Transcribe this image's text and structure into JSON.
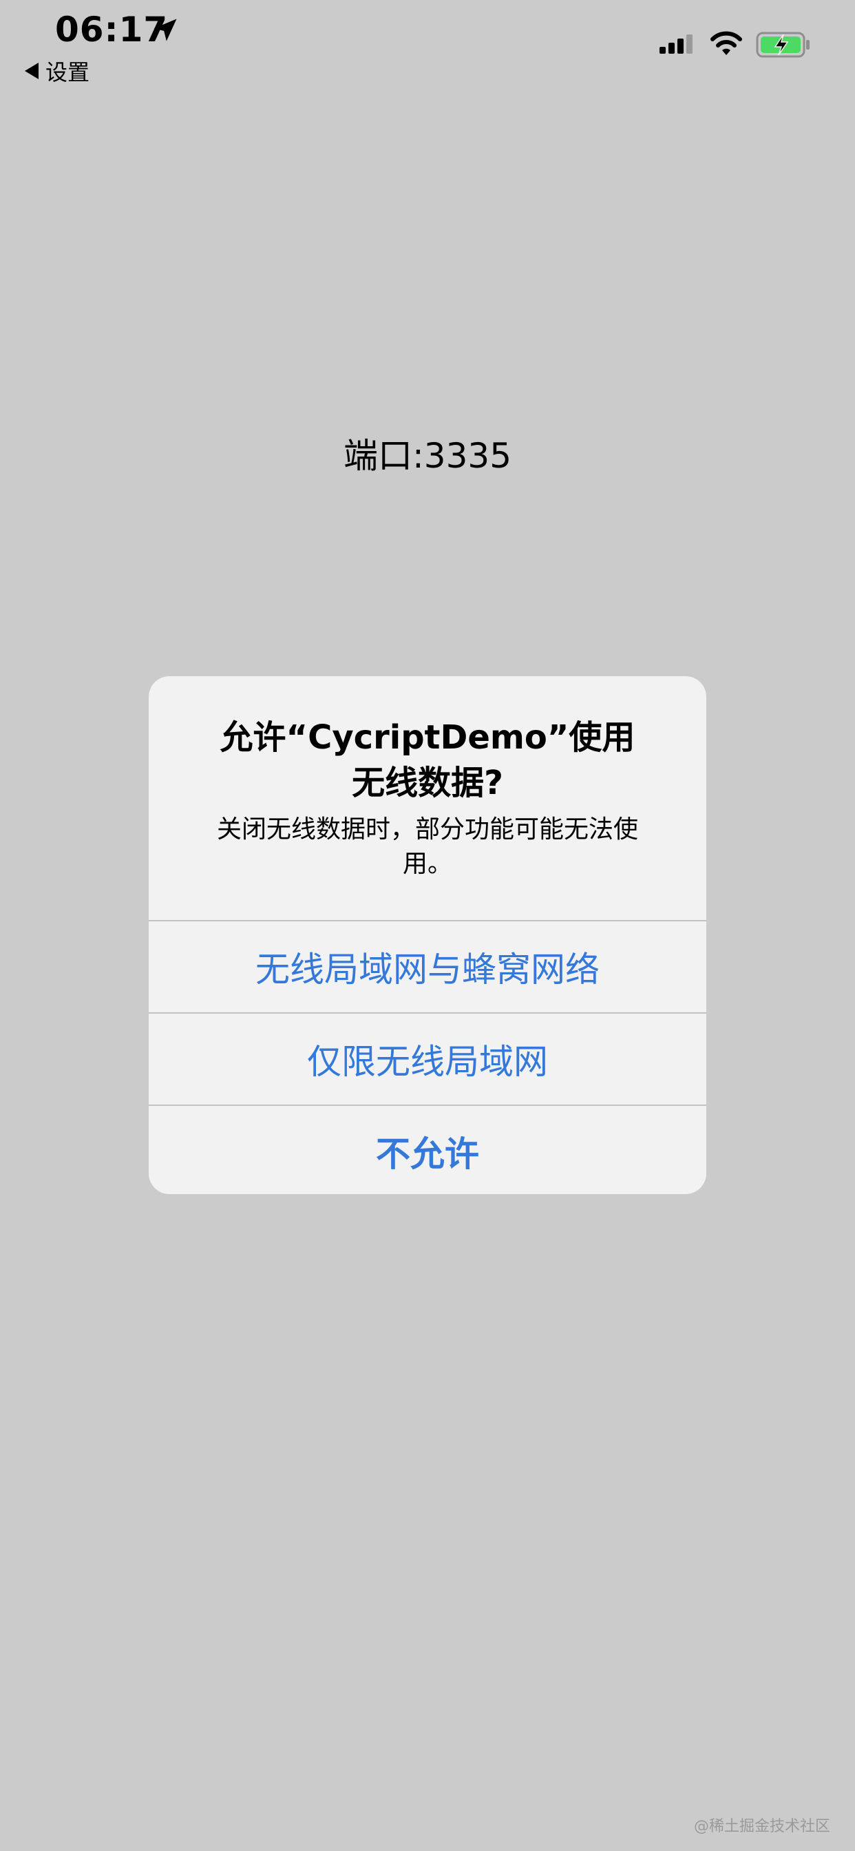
{
  "status_bar": {
    "time": "06:17",
    "back_label": "设置"
  },
  "main": {
    "port_label": "端口:3335"
  },
  "alert": {
    "title": "允许“CycriptDemo”使用无线数据?",
    "message": "关闭无线数据时，部分功能可能无法使用。",
    "buttons": [
      "无线局域网与蜂窝网络",
      "仅限无线局域网",
      "不允许"
    ]
  },
  "watermark": "@稀土掘金技术社区",
  "colors": {
    "background": "#cbcbcb",
    "alert_background": "#f2f2f2",
    "button_text": "#3478d9",
    "battery_green": "#4cd964"
  }
}
